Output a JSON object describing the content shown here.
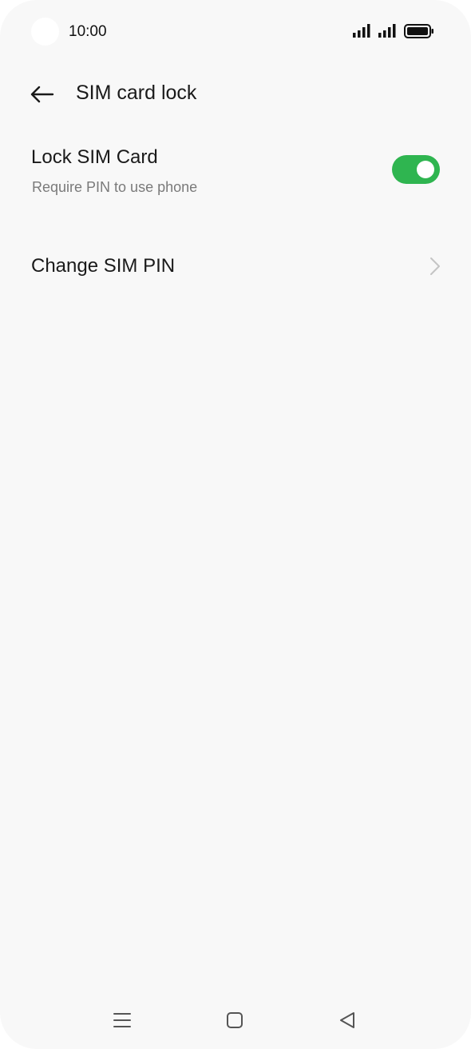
{
  "status_bar": {
    "time": "10:00",
    "icons": [
      "signal-icon",
      "signal-icon",
      "battery-icon"
    ]
  },
  "header": {
    "back_icon": "arrow-left-icon",
    "title": "SIM card lock"
  },
  "settings": {
    "lock_sim": {
      "title": "Lock SIM Card",
      "subtitle": "Require PIN to use phone",
      "enabled": true,
      "toggle_color": "#2fb550"
    },
    "change_pin": {
      "title": "Change SIM PIN",
      "icon": "chevron-right-icon"
    }
  },
  "nav_bar": {
    "buttons": [
      "menu-icon",
      "home-icon",
      "back-triangle-icon"
    ]
  }
}
